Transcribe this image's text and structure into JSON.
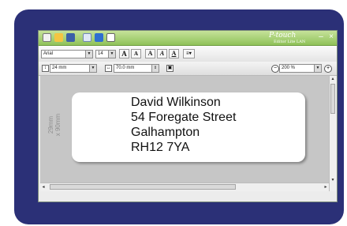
{
  "app": {
    "brand": "P-touch",
    "brand_sub": "Editor Lite LAN",
    "window_controls": [
      "–",
      "×"
    ]
  },
  "toolbar": {
    "font_name": "Arial",
    "font_size": "14",
    "tape_width": "24 mm",
    "tape_length": "70.0 mm",
    "zoom": "200 %",
    "style_buttons": [
      "A",
      "A",
      "A",
      "A",
      "A"
    ]
  },
  "canvas": {
    "dimension_label_line1": "29mm",
    "dimension_label_line2": "x 90mm"
  },
  "label": {
    "lines": [
      "David Wilkinson",
      "54 Foregate Street",
      "Galhampton",
      "RH12 7YA"
    ]
  },
  "colors": {
    "frame": "#2b3077",
    "titlebar": "#8fc259",
    "print_button": "#5e9d2a"
  }
}
